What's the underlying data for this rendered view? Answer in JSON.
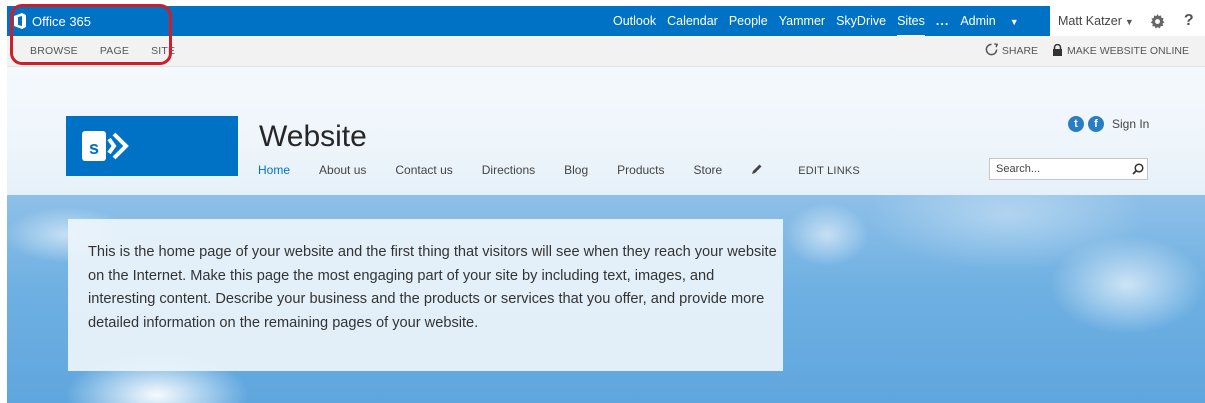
{
  "suitebar": {
    "brand": "Office 365",
    "links": [
      "Outlook",
      "Calendar",
      "People",
      "Yammer",
      "SkyDrive",
      "Sites"
    ],
    "ellipsis": "...",
    "admin": "Admin",
    "user": "Matt Katzer",
    "help": "?"
  },
  "ribbon": {
    "tabs": [
      "BROWSE",
      "PAGE",
      "SITE"
    ],
    "share": "SHARE",
    "make_online": "MAKE WEBSITE ONLINE"
  },
  "site": {
    "title": "Website",
    "nav": [
      "Home",
      "About us",
      "Contact us",
      "Directions",
      "Blog",
      "Products",
      "Store"
    ],
    "edit_links": "EDIT LINKS",
    "sign_in": "Sign In",
    "search_placeholder": "Search..."
  },
  "content": {
    "body": "This is the home page of your website and the first thing that visitors will see when they reach your website on the Internet. Make this page the most engaging part of your site by including text, images, and interesting content. Describe your business and the products or services that you offer, and provide more detailed information on the remaining pages of your website."
  },
  "colors": {
    "brand_blue": "#0072c6",
    "highlight_red": "#cc1f2b"
  }
}
